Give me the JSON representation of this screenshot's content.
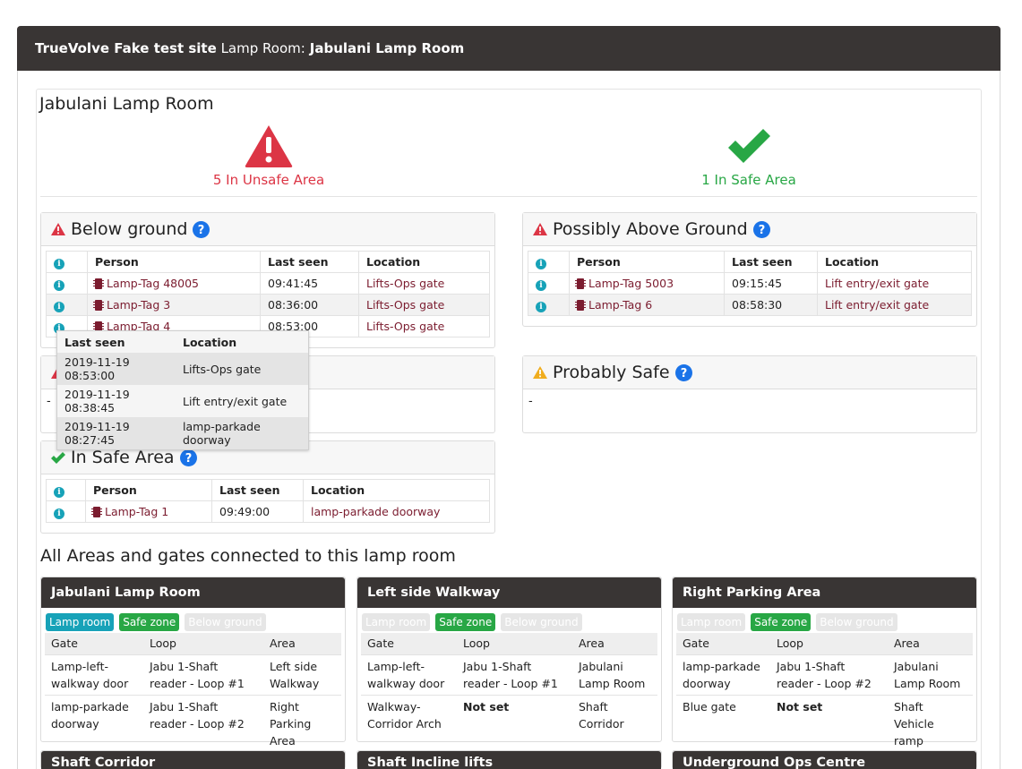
{
  "header": {
    "site": "TrueVolve Fake test site",
    "label": "Lamp Room:",
    "room": "Jabulani Lamp Room"
  },
  "room_title": "Jabulani Lamp Room",
  "status": {
    "unsafe": "5 In Unsafe Area",
    "safe": "1 In Safe Area",
    "unsafe_color": "#dc3545",
    "safe_color": "#28a745"
  },
  "columns": {
    "person": "Person",
    "last_seen": "Last seen",
    "location": "Location"
  },
  "below_ground": {
    "title": "Below ground",
    "rows": [
      {
        "person": "Lamp-Tag 48005",
        "last_seen": "09:41:45",
        "location": "Lifts-Ops gate"
      },
      {
        "person": "Lamp-Tag 3",
        "last_seen": "08:36:00",
        "location": "Lifts-Ops gate"
      },
      {
        "person": "Lamp-Tag 4",
        "last_seen": "08:53:00",
        "location": "Lifts-Ops gate"
      }
    ]
  },
  "tooltip": {
    "rows": [
      {
        "last_seen": "2019-11-19 08:53:00",
        "location": "Lifts-Ops gate"
      },
      {
        "last_seen": "2019-11-19 08:38:45",
        "location": "Lift entry/exit gate"
      },
      {
        "last_seen": "2019-11-19 08:27:45",
        "location": "lamp-parkade doorway"
      }
    ]
  },
  "hidden_panel": {
    "body": "-"
  },
  "in_safe_area": {
    "title": "In Safe Area",
    "rows": [
      {
        "person": "Lamp-Tag 1",
        "last_seen": "09:49:00",
        "location": "lamp-parkade doorway"
      }
    ]
  },
  "possibly_above": {
    "title": "Possibly Above Ground",
    "rows": [
      {
        "person": "Lamp-Tag 5003",
        "last_seen": "09:15:45",
        "location": "Lift entry/exit gate"
      },
      {
        "person": "Lamp-Tag 6",
        "last_seen": "08:58:30",
        "location": "Lift entry/exit gate"
      }
    ]
  },
  "probably_safe": {
    "title": "Probably Safe",
    "body": "-"
  },
  "areas_title": "All Areas and gates connected to this lamp room",
  "badge_labels": {
    "lamp": "Lamp room",
    "safe": "Safe zone",
    "below": "Below ground"
  },
  "gate_columns": {
    "gate": "Gate",
    "loop": "Loop",
    "area": "Area"
  },
  "areas": [
    {
      "name": "Jabulani Lamp Room",
      "rows": [
        {
          "gate": "Lamp-left-walkway door",
          "loop": "Jabu 1-Shaft reader - Loop #1",
          "area": "Left side Walkway"
        },
        {
          "gate": "lamp-parkade doorway",
          "loop": "Jabu 1-Shaft reader - Loop #2",
          "area": "Right Parking Area"
        }
      ]
    },
    {
      "name": "Left side Walkway",
      "rows": [
        {
          "gate": "Lamp-left-walkway door",
          "loop": "Jabu 1-Shaft reader - Loop #1",
          "area": "Jabulani Lamp Room"
        },
        {
          "gate": "Walkway-Corridor Arch",
          "loop": "Not set",
          "area": "Shaft Corridor"
        }
      ]
    },
    {
      "name": "Right Parking Area",
      "rows": [
        {
          "gate": "lamp-parkade doorway",
          "loop": "Jabu 1-Shaft reader - Loop #2",
          "area": "Jabulani Lamp Room"
        },
        {
          "gate": "Blue gate",
          "loop": "Not set",
          "area": "Shaft Vehicle ramp"
        }
      ]
    },
    {
      "name": "Shaft Corridor"
    },
    {
      "name": "Shaft Incline lifts"
    },
    {
      "name": "Underground Ops Centre"
    }
  ]
}
